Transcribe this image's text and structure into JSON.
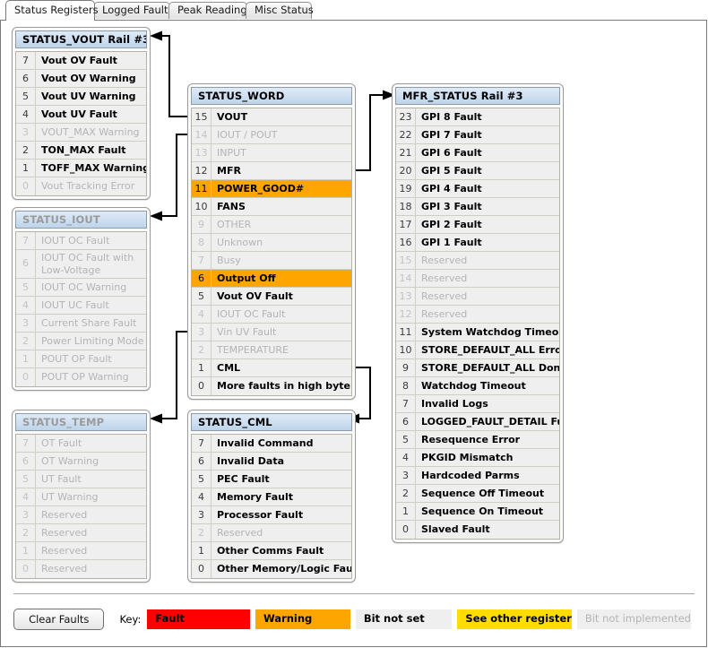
{
  "tabs": [
    {
      "label": "Status Registers",
      "active": true
    },
    {
      "label": "Logged Faults",
      "active": false
    },
    {
      "label": "Peak Readings",
      "active": false
    },
    {
      "label": "Misc Status",
      "active": false
    }
  ],
  "registers": {
    "status_vout": {
      "title": "STATUS_VOUT Rail #3",
      "title_dim": false,
      "rows": [
        {
          "bit": "7",
          "label": "Vout OV Fault",
          "state": "notset"
        },
        {
          "bit": "6",
          "label": "Vout OV Warning",
          "state": "notset"
        },
        {
          "bit": "5",
          "label": "Vout UV Warning",
          "state": "notset"
        },
        {
          "bit": "4",
          "label": "Vout UV Fault",
          "state": "notset"
        },
        {
          "bit": "3",
          "label": "VOUT_MAX Warning",
          "state": "notimpl"
        },
        {
          "bit": "2",
          "label": "TON_MAX Fault",
          "state": "notset"
        },
        {
          "bit": "1",
          "label": "TOFF_MAX Warning",
          "state": "notset"
        },
        {
          "bit": "0",
          "label": "Vout Tracking Error",
          "state": "notimpl"
        }
      ]
    },
    "status_iout": {
      "title": "STATUS_IOUT",
      "title_dim": true,
      "rows": [
        {
          "bit": "7",
          "label": "IOUT OC Fault",
          "state": "notimpl"
        },
        {
          "bit": "6",
          "label": "IOUT OC Fault with Low-Voltage Shutdown",
          "state": "notimpl",
          "tall": true
        },
        {
          "bit": "5",
          "label": "IOUT OC Warning",
          "state": "notimpl"
        },
        {
          "bit": "4",
          "label": "IOUT UC Fault",
          "state": "notimpl"
        },
        {
          "bit": "3",
          "label": "Current Share Fault",
          "state": "notimpl"
        },
        {
          "bit": "2",
          "label": "Power Limiting Mode",
          "state": "notimpl"
        },
        {
          "bit": "1",
          "label": "POUT OP Fault",
          "state": "notimpl"
        },
        {
          "bit": "0",
          "label": "POUT OP Warning",
          "state": "notimpl"
        }
      ]
    },
    "status_temp": {
      "title": "STATUS_TEMP",
      "title_dim": true,
      "rows": [
        {
          "bit": "7",
          "label": "OT Fault",
          "state": "notimpl"
        },
        {
          "bit": "6",
          "label": "OT Warning",
          "state": "notimpl"
        },
        {
          "bit": "5",
          "label": "UT Fault",
          "state": "notimpl"
        },
        {
          "bit": "4",
          "label": "UT Warning",
          "state": "notimpl"
        },
        {
          "bit": "3",
          "label": "Reserved",
          "state": "notimpl"
        },
        {
          "bit": "2",
          "label": "Reserved",
          "state": "notimpl"
        },
        {
          "bit": "1",
          "label": "Reserved",
          "state": "notimpl"
        },
        {
          "bit": "0",
          "label": "Reserved",
          "state": "notimpl"
        }
      ]
    },
    "status_word": {
      "title": "STATUS_WORD",
      "title_dim": false,
      "rows": [
        {
          "bit": "15",
          "label": "VOUT",
          "state": "notset"
        },
        {
          "bit": "14",
          "label": "IOUT / POUT",
          "state": "notimpl"
        },
        {
          "bit": "13",
          "label": "INPUT",
          "state": "notimpl"
        },
        {
          "bit": "12",
          "label": "MFR",
          "state": "notset"
        },
        {
          "bit": "11",
          "label": "POWER_GOOD#",
          "state": "warning"
        },
        {
          "bit": "10",
          "label": "FANS",
          "state": "notset"
        },
        {
          "bit": "9",
          "label": "OTHER",
          "state": "notimpl"
        },
        {
          "bit": "8",
          "label": "Unknown",
          "state": "notimpl"
        },
        {
          "bit": "7",
          "label": "Busy",
          "state": "notimpl"
        },
        {
          "bit": "6",
          "label": "Output Off",
          "state": "warning"
        },
        {
          "bit": "5",
          "label": "Vout OV Fault",
          "state": "notset"
        },
        {
          "bit": "4",
          "label": "IOUT OC Fault",
          "state": "notimpl"
        },
        {
          "bit": "3",
          "label": "Vin UV Fault",
          "state": "notimpl"
        },
        {
          "bit": "2",
          "label": "TEMPERATURE",
          "state": "notimpl"
        },
        {
          "bit": "1",
          "label": "CML",
          "state": "notset"
        },
        {
          "bit": "0",
          "label": "More faults in high byte",
          "state": "notset"
        }
      ]
    },
    "status_cml": {
      "title": "STATUS_CML",
      "title_dim": false,
      "rows": [
        {
          "bit": "7",
          "label": "Invalid Command",
          "state": "notset"
        },
        {
          "bit": "6",
          "label": "Invalid Data",
          "state": "notset"
        },
        {
          "bit": "5",
          "label": "PEC Fault",
          "state": "notset"
        },
        {
          "bit": "4",
          "label": "Memory Fault",
          "state": "notset"
        },
        {
          "bit": "3",
          "label": "Processor Fault",
          "state": "notset"
        },
        {
          "bit": "2",
          "label": "Reserved",
          "state": "notimpl"
        },
        {
          "bit": "1",
          "label": "Other Comms Fault",
          "state": "notset"
        },
        {
          "bit": "0",
          "label": "Other Memory/Logic Fault",
          "state": "notset"
        }
      ]
    },
    "mfr_status": {
      "title": "MFR_STATUS Rail #3",
      "title_dim": false,
      "rows": [
        {
          "bit": "23",
          "label": "GPI 8 Fault",
          "state": "notset"
        },
        {
          "bit": "22",
          "label": "GPI 7 Fault",
          "state": "notset"
        },
        {
          "bit": "21",
          "label": "GPI 6 Fault",
          "state": "notset"
        },
        {
          "bit": "20",
          "label": "GPI 5 Fault",
          "state": "notset"
        },
        {
          "bit": "19",
          "label": "GPI 4 Fault",
          "state": "notset"
        },
        {
          "bit": "18",
          "label": "GPI 3 Fault",
          "state": "notset"
        },
        {
          "bit": "17",
          "label": "GPI 2 Fault",
          "state": "notset"
        },
        {
          "bit": "16",
          "label": "GPI 1 Fault",
          "state": "notset"
        },
        {
          "bit": "15",
          "label": "Reserved",
          "state": "notimpl"
        },
        {
          "bit": "14",
          "label": "Reserved",
          "state": "notimpl"
        },
        {
          "bit": "13",
          "label": "Reserved",
          "state": "notimpl"
        },
        {
          "bit": "12",
          "label": "Reserved",
          "state": "notimpl"
        },
        {
          "bit": "11",
          "label": "System Watchdog Timeout",
          "state": "notset"
        },
        {
          "bit": "10",
          "label": "STORE_DEFAULT_ALL Error",
          "state": "notset"
        },
        {
          "bit": "9",
          "label": "STORE_DEFAULT_ALL Done",
          "state": "notset"
        },
        {
          "bit": "8",
          "label": "Watchdog Timeout",
          "state": "notset"
        },
        {
          "bit": "7",
          "label": "Invalid Logs",
          "state": "notset"
        },
        {
          "bit": "6",
          "label": "LOGGED_FAULT_DETAIL Full",
          "state": "notset"
        },
        {
          "bit": "5",
          "label": "Resequence Error",
          "state": "notset"
        },
        {
          "bit": "4",
          "label": "PKGID Mismatch",
          "state": "notset"
        },
        {
          "bit": "3",
          "label": "Hardcoded Parms",
          "state": "notset"
        },
        {
          "bit": "2",
          "label": "Sequence Off Timeout",
          "state": "notset"
        },
        {
          "bit": "1",
          "label": "Sequence On Timeout",
          "state": "notset"
        },
        {
          "bit": "0",
          "label": "Slaved Fault",
          "state": "notset"
        }
      ]
    }
  },
  "footer": {
    "clear_faults_label": "Clear Faults",
    "key_label": "Key:",
    "legend": [
      {
        "label": "Fault",
        "color": "#ff0000",
        "state": "fault"
      },
      {
        "label": "Warning",
        "color": "#ffa500",
        "state": "warning"
      },
      {
        "label": "Bit not set",
        "color": "#efefef",
        "state": "notset"
      },
      {
        "label": "See other register",
        "color": "#ffdd00",
        "state": "seeother"
      },
      {
        "label": "Bit not implemented",
        "color": "#efefef",
        "state": "notimpl"
      }
    ]
  }
}
